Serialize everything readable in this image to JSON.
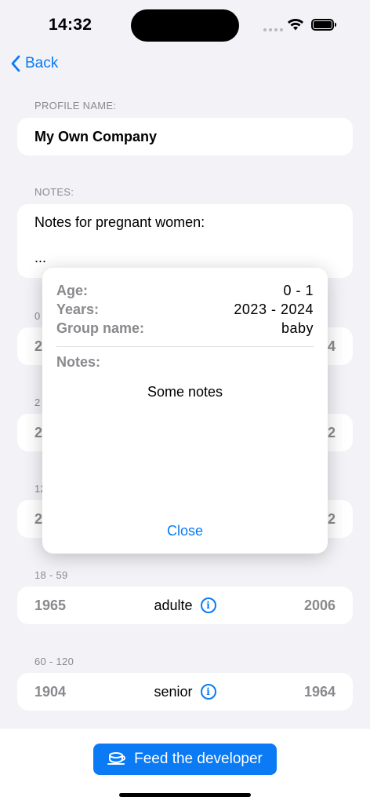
{
  "status": {
    "time": "14:32"
  },
  "nav": {
    "back_label": "Back"
  },
  "profile": {
    "section_label": "PROFILE NAME:",
    "name": "My Own Company"
  },
  "notes": {
    "section_label": "NOTES:",
    "line1": "Notes for pregnant women:",
    "line2": "..."
  },
  "groups": [
    {
      "range_label": "0",
      "start_year": "2",
      "name": "",
      "end_year": "4"
    },
    {
      "range_label": "2",
      "start_year": "2",
      "name": "",
      "end_year": "2"
    },
    {
      "range_label": "12",
      "start_year": "2",
      "name": "",
      "end_year": "2"
    },
    {
      "range_label": "18 - 59",
      "start_year": "1965",
      "name": "adulte",
      "end_year": "2006"
    },
    {
      "range_label": "60 - 120",
      "start_year": "1904",
      "name": "senior",
      "end_year": "1964"
    }
  ],
  "popup": {
    "age_label": "Age:",
    "age_value": "0 - 1",
    "years_label": "Years:",
    "years_value": "2023 - 2024",
    "group_label": "Group name:",
    "group_value": "baby",
    "notes_label": "Notes:",
    "notes_value": "Some notes",
    "close_label": "Close"
  },
  "footer": {
    "feed_button_label": "Feed the developer",
    "icon": "coffee-cup-icon"
  },
  "colors": {
    "accent": "#0a7af5",
    "background": "#f2f2f7",
    "secondary_text": "#8a8a8e"
  }
}
